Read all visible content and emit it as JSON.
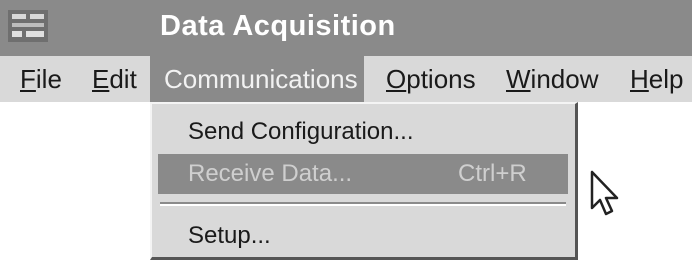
{
  "window": {
    "title": "Data Acquisition",
    "app_icon": "app-icon"
  },
  "menubar": [
    {
      "label": "File",
      "mnemonic": "F"
    },
    {
      "label": "Edit",
      "mnemonic": "E"
    },
    {
      "label": "Communications",
      "mnemonic": "C",
      "active": true
    },
    {
      "label": "Options",
      "mnemonic": "O"
    },
    {
      "label": "Window",
      "mnemonic": "W"
    },
    {
      "label": "Help",
      "mnemonic": "H"
    }
  ],
  "communications_menu": {
    "items": [
      {
        "label": "Send Configuration...",
        "shortcut": ""
      },
      {
        "label": "Receive Data...",
        "shortcut": "Ctrl+R",
        "highlighted": true,
        "disabled": true
      },
      {
        "label": "Setup...",
        "shortcut": ""
      }
    ]
  },
  "colors": {
    "titlebar": "#8a8a8a",
    "menubar": "#d9d9d9",
    "highlight": "#8a8a8a"
  },
  "cursor_icon": "arrow-cursor-icon"
}
